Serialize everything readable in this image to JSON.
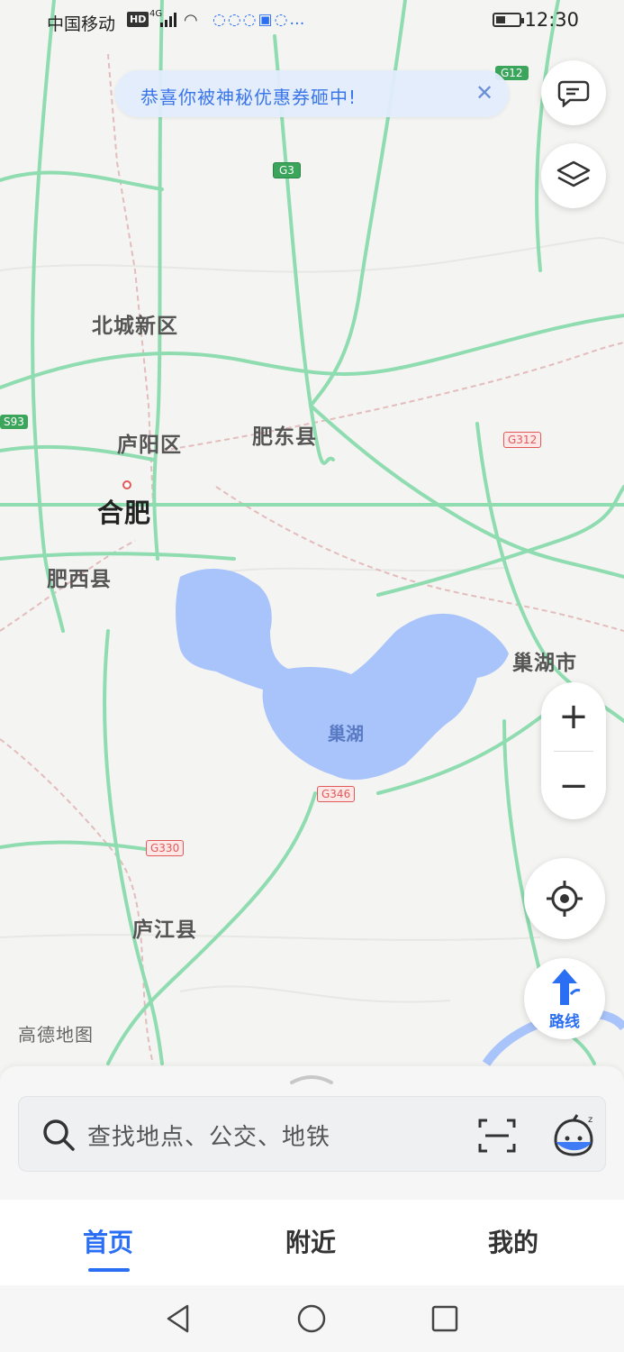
{
  "status_bar": {
    "carrier": "中国移动",
    "hd_badge": "HD",
    "network": "4G",
    "time": "12:30"
  },
  "banner": {
    "text": "恭喜你被神秘优惠券砸中!",
    "close_icon": "close-icon"
  },
  "map": {
    "place_labels": [
      {
        "name": "北城新区"
      },
      {
        "name": "庐阳区"
      },
      {
        "name": "肥东县"
      },
      {
        "name": "合肥"
      },
      {
        "name": "肥西县"
      },
      {
        "name": "巢湖市"
      },
      {
        "name": "巢湖"
      },
      {
        "name": "庐江县"
      }
    ],
    "road_shields": [
      {
        "code": "G3"
      },
      {
        "code": "G312"
      },
      {
        "code": "G346"
      },
      {
        "code": "G330"
      },
      {
        "code": "S93"
      },
      {
        "code": "G12"
      }
    ],
    "watermark": "高德地图",
    "colors": {
      "road": "#8fdcb0",
      "water": "#a9c4fb",
      "rail": "#e3bcbc",
      "shield_red": "#e05a5a",
      "shield_green": "#3ba55c"
    }
  },
  "controls": {
    "feedback_icon": "message-icon",
    "layers_icon": "layers-icon",
    "zoom_in": "+",
    "zoom_out": "−",
    "locate_icon": "locate-icon",
    "route_label": "路线"
  },
  "search": {
    "placeholder": "查找地点、公交、地铁"
  },
  "tabs": [
    {
      "label": "首页",
      "active": true
    },
    {
      "label": "附近",
      "active": false
    },
    {
      "label": "我的",
      "active": false
    }
  ],
  "accent": "#2a6ef4"
}
